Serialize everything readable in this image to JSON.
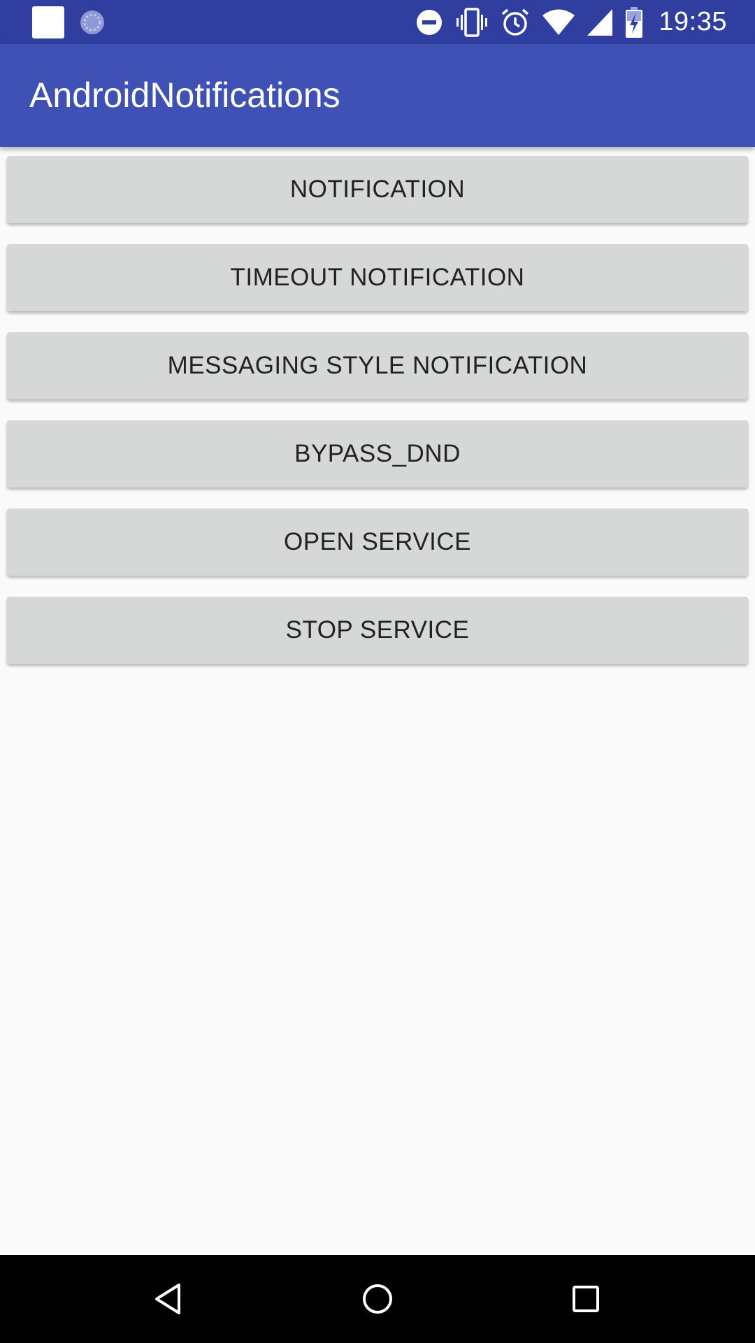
{
  "status_bar": {
    "time": "19:35",
    "icons": [
      "app-notification-icon",
      "sync-icon",
      "do-not-disturb-icon",
      "vibrate-icon",
      "alarm-icon",
      "wifi-icon",
      "cell-signal-icon",
      "battery-charging-icon"
    ]
  },
  "app_bar": {
    "title": "AndroidNotifications"
  },
  "buttons": [
    {
      "label": "NOTIFICATION"
    },
    {
      "label": "TIMEOUT NOTIFICATION"
    },
    {
      "label": "MESSAGING STYLE NOTIFICATION"
    },
    {
      "label": "BYPASS_DND"
    },
    {
      "label": "OPEN SERVICE"
    },
    {
      "label": "STOP SERVICE"
    }
  ],
  "nav_bar": {
    "icons": [
      "back-icon",
      "home-icon",
      "recents-icon"
    ]
  },
  "colors": {
    "status_bar": "#303f9f",
    "app_bar": "#3f51b5",
    "button": "#d6d7d7",
    "background": "#fafafa"
  }
}
